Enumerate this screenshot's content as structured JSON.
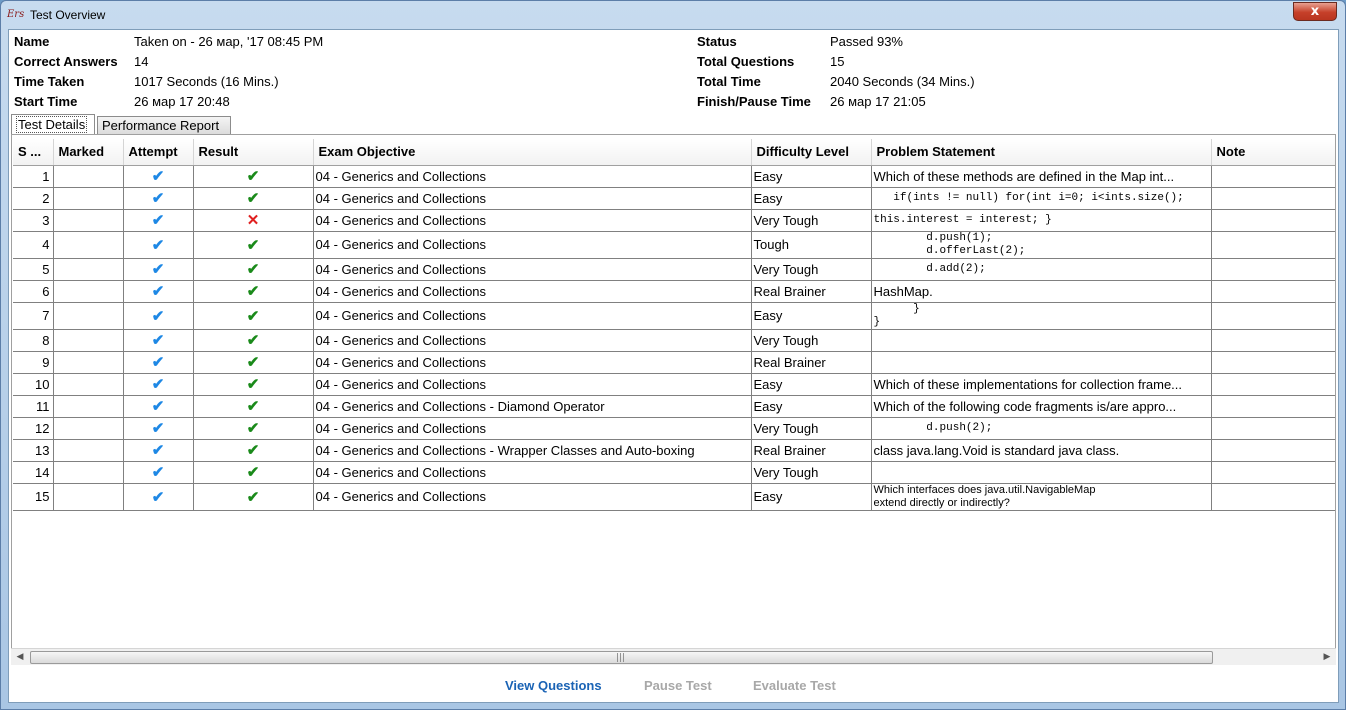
{
  "window": {
    "title": "Test Overview",
    "app_icon_label": "Ers",
    "close_label": "x"
  },
  "summary": {
    "name_label": "Name",
    "name_value": "Taken on - 26 мар, '17 08:45 PM",
    "correct_label": "Correct Answers",
    "correct_value": "14",
    "time_taken_label": "Time Taken",
    "time_taken_value": "1017 Seconds (16 Mins.)",
    "start_label": "Start Time",
    "start_value": "26 мар 17 20:48",
    "status_label": "Status",
    "status_value": "Passed 93%",
    "total_q_label": "Total Questions",
    "total_q_value": "15",
    "total_time_label": "Total Time",
    "total_time_value": "2040 Seconds (34 Mins.)",
    "finish_label": "Finish/Pause Time",
    "finish_value": "26 мар 17 21:05"
  },
  "tabs": [
    {
      "label": "Test Details",
      "active": true
    },
    {
      "label": "Performance Report",
      "active": false
    }
  ],
  "table": {
    "headers": [
      "S ...",
      "Marked",
      "Attempt",
      "Result",
      "Exam Objective",
      "Difficulty Level",
      "Problem Statement",
      "Note"
    ],
    "rows": [
      {
        "s": "1",
        "result": "correct",
        "objective": "04 - Generics and Collections",
        "difficulty": "Easy",
        "problem": "Which of these methods are defined in the Map int...",
        "problem_mono": false
      },
      {
        "s": "2",
        "result": "correct",
        "objective": "04 - Generics and Collections",
        "difficulty": "Easy",
        "problem": "   if(ints != null) for(int i=0; i<ints.size();",
        "problem_mono": true
      },
      {
        "s": "3",
        "result": "wrong",
        "objective": "04 - Generics and Collections",
        "difficulty": "Very Tough",
        "problem": "this.interest = interest; }",
        "problem_mono": true
      },
      {
        "s": "4",
        "result": "correct",
        "objective": "04 - Generics and Collections",
        "difficulty": "Tough",
        "problem": "        d.push(1);\n        d.offerLast(2);",
        "problem_mono": true
      },
      {
        "s": "5",
        "result": "correct",
        "objective": "04 - Generics and Collections",
        "difficulty": "Very Tough",
        "problem": "        d.add(2);",
        "problem_mono": true
      },
      {
        "s": "6",
        "result": "correct",
        "objective": "04 - Generics and Collections",
        "difficulty": "Real Brainer",
        "problem": "HashMap.",
        "problem_mono": false
      },
      {
        "s": "7",
        "result": "correct",
        "objective": "04 - Generics and Collections",
        "difficulty": "Easy",
        "problem": "      }\n}",
        "problem_mono": true
      },
      {
        "s": "8",
        "result": "correct",
        "objective": "04 - Generics and Collections",
        "difficulty": "Very Tough",
        "problem": "",
        "problem_mono": false
      },
      {
        "s": "9",
        "result": "correct",
        "objective": "04 - Generics and Collections",
        "difficulty": "Real Brainer",
        "problem": "",
        "problem_mono": false
      },
      {
        "s": "10",
        "result": "correct",
        "objective": "04 - Generics and Collections",
        "difficulty": "Easy",
        "problem": "Which of these implementations for collection frame...",
        "problem_mono": false
      },
      {
        "s": "11",
        "result": "correct",
        "objective": "04 - Generics and Collections - Diamond Operator",
        "difficulty": "Easy",
        "problem": "Which of the following code fragments is/are appro...",
        "problem_mono": false
      },
      {
        "s": "12",
        "result": "correct",
        "objective": "04 - Generics and Collections",
        "difficulty": "Very Tough",
        "problem": "        d.push(2);",
        "problem_mono": true
      },
      {
        "s": "13",
        "result": "correct",
        "objective": "04 - Generics and Collections - Wrapper Classes and Auto-boxing",
        "difficulty": "Real Brainer",
        "problem": "class java.lang.Void is standard java class.",
        "problem_mono": false
      },
      {
        "s": "14",
        "result": "correct",
        "objective": "04 - Generics and Collections",
        "difficulty": "Very Tough",
        "problem": "",
        "problem_mono": false
      },
      {
        "s": "15",
        "result": "correct",
        "objective": "04 - Generics and Collections",
        "difficulty": "Easy",
        "problem": "Which interfaces does java.util.NavigableMap\nextend directly or indirectly?",
        "problem_mono": false
      }
    ]
  },
  "icons": {
    "attempt": "check-icon",
    "correct": "check-icon",
    "wrong": "cross-icon",
    "attempt_color": "#1e88e5",
    "correct_color": "#1a8a1a",
    "wrong_color": "#e02020"
  },
  "footer": {
    "view_questions": "View Questions",
    "pause_test": "Pause Test",
    "evaluate_test": "Evaluate Test"
  }
}
